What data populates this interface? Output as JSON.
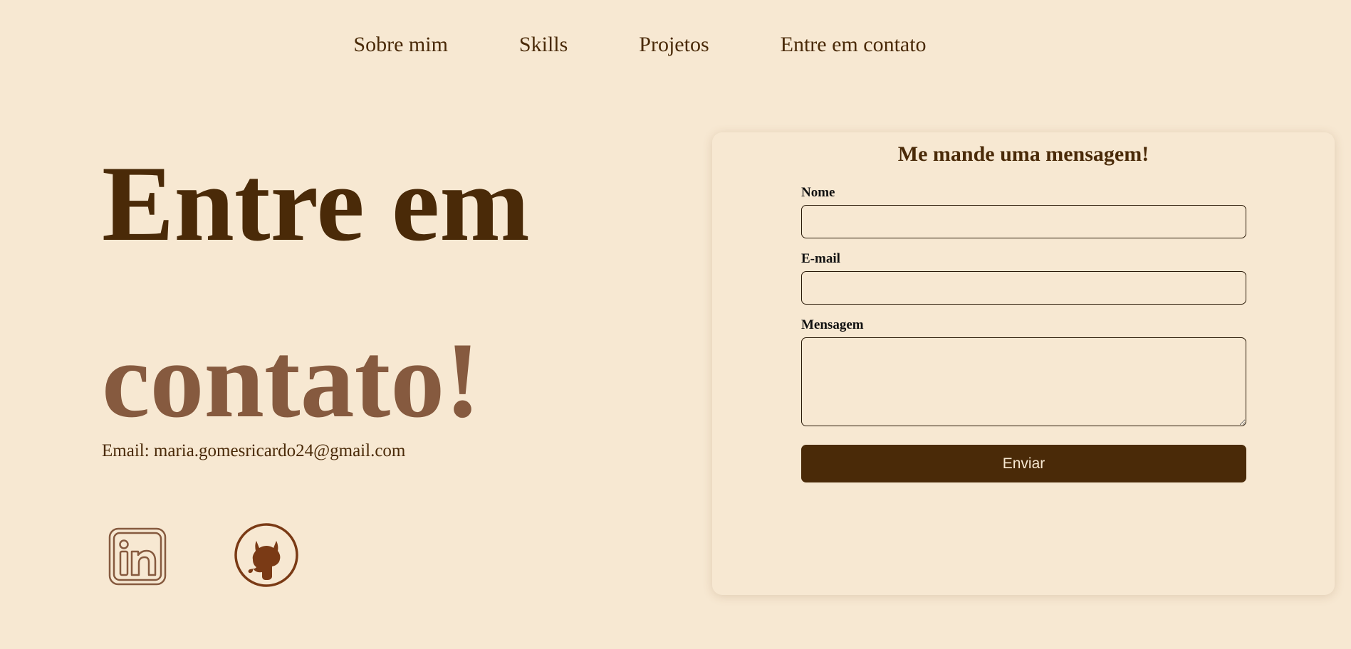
{
  "nav": {
    "items": [
      {
        "label": "Sobre mim"
      },
      {
        "label": "Skills"
      },
      {
        "label": "Projetos"
      },
      {
        "label": "Entre em contato"
      }
    ]
  },
  "hero": {
    "title_line1": "Entre em",
    "title_line2": "contato!",
    "email": "Email: maria.gomesricardo24@gmail.com"
  },
  "social": {
    "linkedin_icon": "linkedin-icon",
    "github_icon": "github-icon"
  },
  "form": {
    "title": "Me mande uma mensagem!",
    "name_label": "Nome",
    "name_value": "",
    "email_label": "E-mail",
    "email_value": "",
    "message_label": "Mensagem",
    "message_value": "",
    "submit_label": "Enviar"
  },
  "colors": {
    "background": "#f7e8d2",
    "primary": "#4a2a08",
    "accent": "#865a3f",
    "github": "#7a3a15"
  }
}
